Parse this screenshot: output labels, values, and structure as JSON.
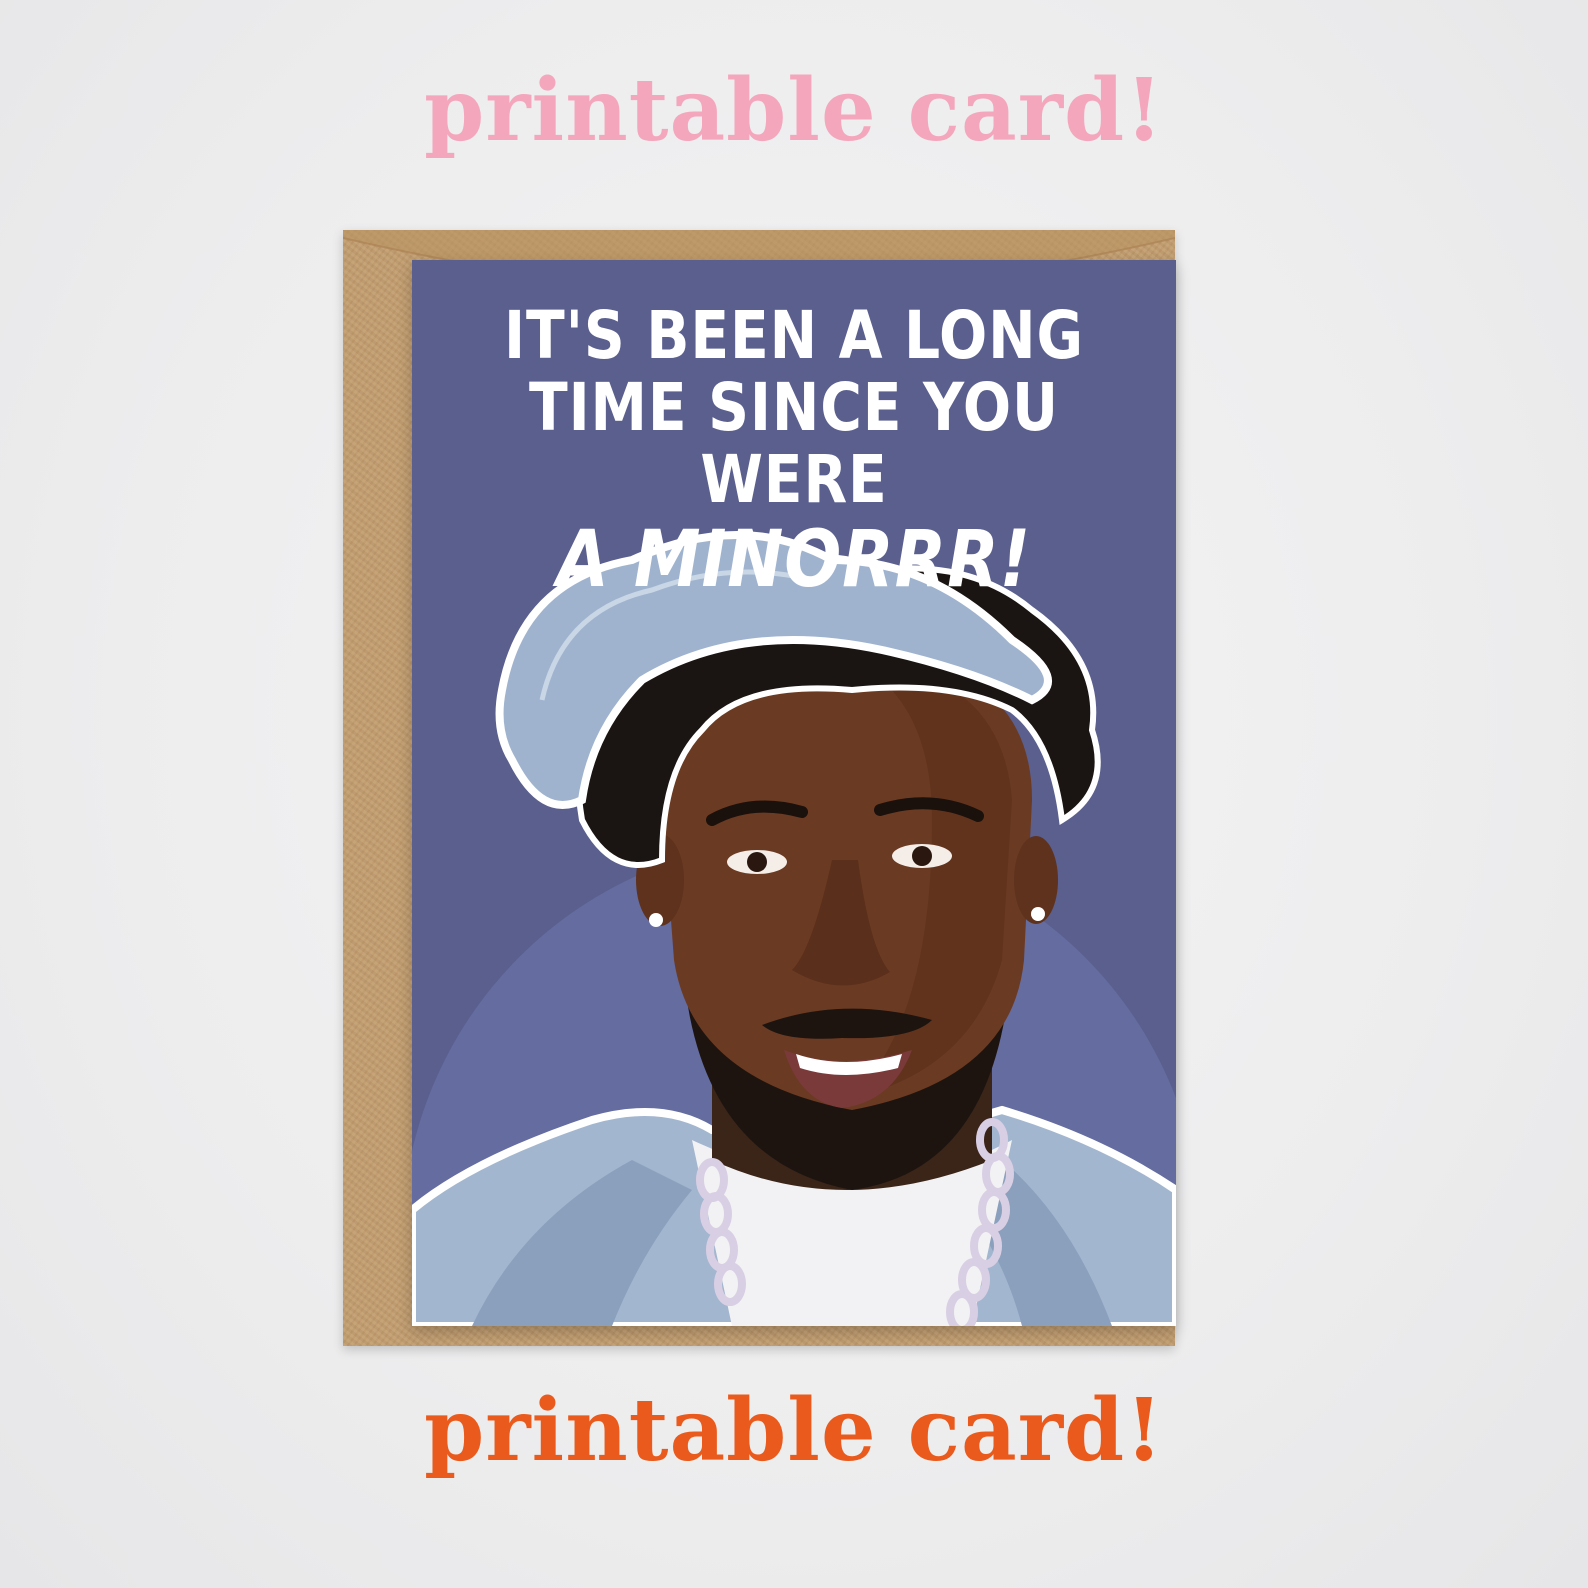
{
  "banner": {
    "top_text": "printable card!",
    "bottom_text": "printable card!",
    "top_color": "#f4a6bc",
    "bottom_color": "#ea5a1c"
  },
  "card": {
    "line1": "IT'S BEEN A LONG",
    "line2": "TIME SINCE YOU WERE",
    "line3": "A MINORRR!",
    "background_color": "#5a5f8e",
    "text_color": "#ffffff"
  },
  "envelope": {
    "color": "#c29d6f"
  }
}
